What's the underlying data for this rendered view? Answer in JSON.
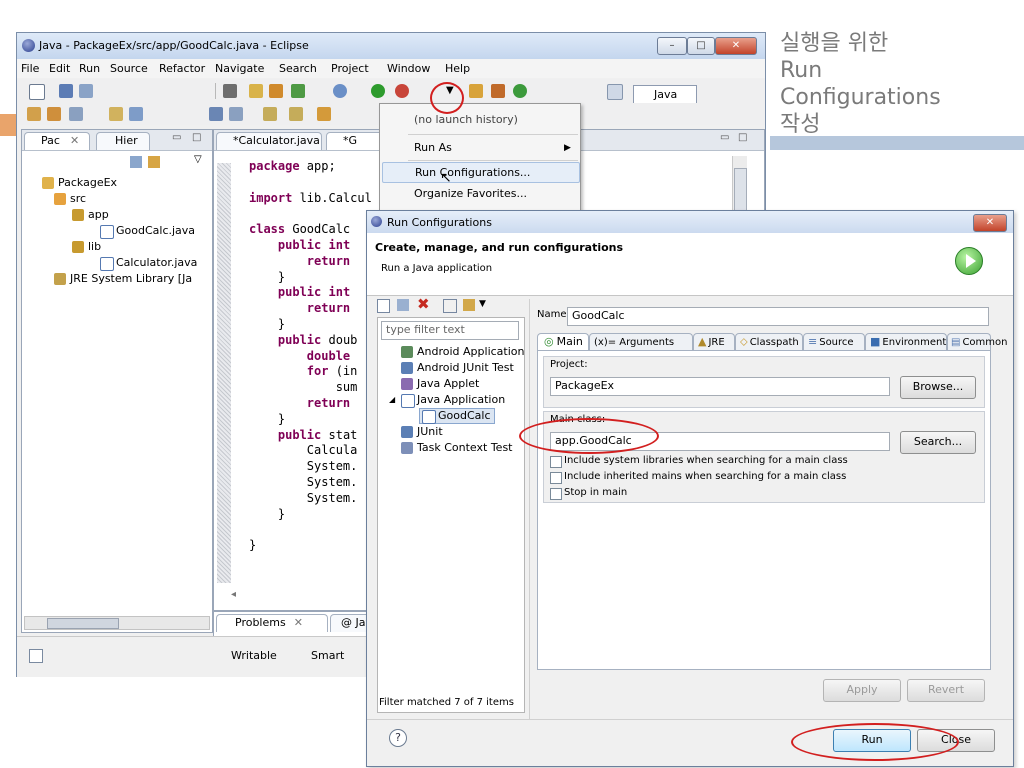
{
  "slide": {
    "title_lines": [
      "실행을 위한",
      "Run",
      "Configurations",
      "작성"
    ]
  },
  "eclipse": {
    "title": "Java - PackageEx/src/app/GoodCalc.java - Eclipse",
    "menu": [
      "File",
      "Edit",
      "Run",
      "Source",
      "Refactor",
      "Navigate",
      "Search",
      "Project",
      "Window",
      "Help"
    ],
    "perspective_label": "Java",
    "left_tabs": [
      "Pac",
      "Hier"
    ],
    "tree": {
      "project": "PackageEx",
      "src": "src",
      "pkg_app": "app",
      "file_goodcalc": "GoodCalc.java",
      "pkg_lib": "lib",
      "file_calculator": "Calculator.java",
      "jre": "JRE System Library [Ja"
    },
    "editor_tabs": [
      "*Calculator.java",
      "*G"
    ],
    "code_lines": [
      "package app;",
      "",
      "import lib.Calcul",
      "",
      "class GoodCalc",
      "    public int",
      "        return",
      "    }",
      "    public int",
      "        return",
      "    }",
      "    public doub",
      "        double",
      "        for (in",
      "            sum",
      "        return",
      "    }",
      "    public stat",
      "        Calcula",
      "        System.",
      "        System.",
      "        System.",
      "    }",
      "",
      "}"
    ],
    "bottom_tabs": [
      "Problems",
      "@ Jav"
    ],
    "status": [
      "Writable",
      "Smart"
    ]
  },
  "dropdown": {
    "items": [
      {
        "label": "(no launch history)",
        "disabled": true
      },
      {
        "label": "Run As",
        "submenu": true
      },
      {
        "label": "Run Configurations...",
        "highlighted": true
      },
      {
        "label": "Organize Favorites..."
      }
    ]
  },
  "dialog": {
    "title": "Run Configurations",
    "header_title": "Create, manage, and run configurations",
    "header_subtitle": "Run a Java application",
    "filter_placeholder": "type filter text",
    "config_types": [
      "Android Application",
      "Android JUnit Test",
      "Java Applet",
      "Java Application",
      "GoodCalc",
      "JUnit",
      "Task Context Test"
    ],
    "filter_status": "Filter matched 7 of 7 items",
    "name_label": "Name:",
    "name_value": "GoodCalc",
    "tabs": [
      "Main",
      "(x)= Arguments",
      "JRE",
      "Classpath",
      "Source",
      "Environment",
      "Common"
    ],
    "project_label": "Project:",
    "project_value": "PackageEx",
    "browse_label": "Browse...",
    "main_class_label": "Main class:",
    "main_class_value": "app.GoodCalc",
    "search_label": "Search...",
    "options": [
      "Include system libraries when searching for a main class",
      "Include inherited mains when searching for a main class",
      "Stop in main"
    ],
    "apply_label": "Apply",
    "revert_label": "Revert",
    "help_symbol": "?",
    "run_label": "Run",
    "close_label": "Close"
  }
}
